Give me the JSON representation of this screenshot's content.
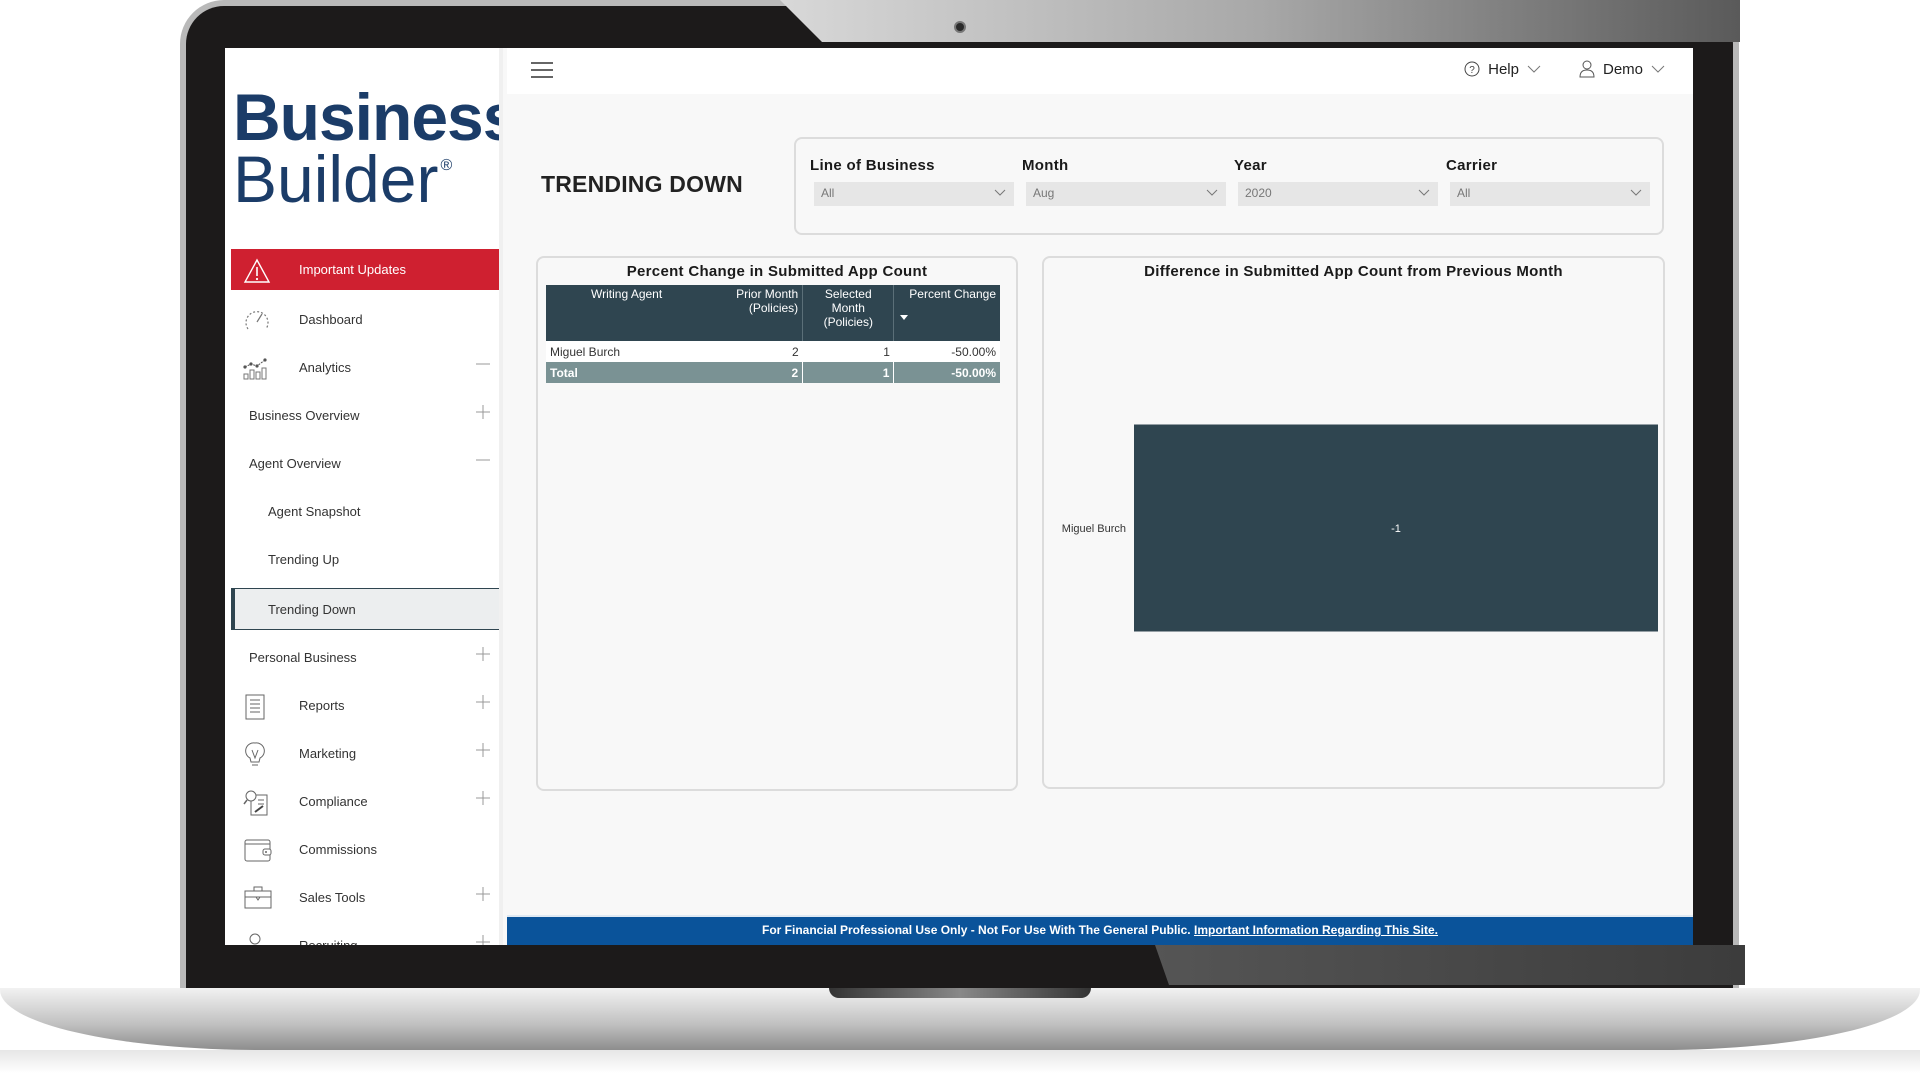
{
  "brand": {
    "line1": "Business",
    "line2": "Builder",
    "reg": "®"
  },
  "topbar": {
    "help_label": "Help",
    "user_label": "Demo"
  },
  "page": {
    "title": "TRENDING DOWN"
  },
  "sidebar": {
    "items": [
      {
        "label": "Important Updates",
        "icon": "warning-icon"
      },
      {
        "label": "Dashboard",
        "icon": "speedometer-icon"
      },
      {
        "label": "Analytics",
        "icon": "analytics-icon",
        "toggle": "minus"
      },
      {
        "label": "Business Overview",
        "toggle": "plus"
      },
      {
        "label": "Agent Overview",
        "toggle": "minus"
      },
      {
        "label": "Agent Snapshot"
      },
      {
        "label": "Trending Up"
      },
      {
        "label": "Trending Down",
        "active": true
      },
      {
        "label": "Personal Business",
        "toggle": "plus"
      },
      {
        "label": "Reports",
        "icon": "document-icon",
        "toggle": "plus"
      },
      {
        "label": "Marketing",
        "icon": "lightbulb-icon",
        "toggle": "plus"
      },
      {
        "label": "Compliance",
        "icon": "compliance-icon",
        "toggle": "plus"
      },
      {
        "label": "Commissions",
        "icon": "wallet-icon"
      },
      {
        "label": "Sales Tools",
        "icon": "briefcase-icon",
        "toggle": "plus"
      },
      {
        "label": "Recruiting",
        "icon": "person-icon",
        "toggle": "plus"
      }
    ]
  },
  "filters": [
    {
      "label": "Line of Business",
      "value": "All"
    },
    {
      "label": "Month",
      "value": "Aug"
    },
    {
      "label": "Year",
      "value": "2020"
    },
    {
      "label": "Carrier",
      "value": "All"
    }
  ],
  "table_panel": {
    "title": "Percent Change in Submitted App Count",
    "columns": [
      "Writing Agent",
      "Prior Month (Policies)",
      "Selected Month (Policies)",
      "Percent Change"
    ],
    "rows": [
      [
        "Miguel Burch",
        "2",
        "1",
        "-50.00%"
      ]
    ],
    "total": [
      "Total",
      "2",
      "1",
      "-50.00%"
    ]
  },
  "chart_data": {
    "type": "bar",
    "orientation": "horizontal",
    "title": "Difference in Submitted App Count from Previous Month",
    "categories": [
      "Miguel Burch"
    ],
    "values": [
      -1
    ],
    "data_labels": [
      "-1"
    ],
    "xlabel": "",
    "ylabel": "",
    "grid": false,
    "bar_color": "#2f4550"
  },
  "footer": {
    "text": "For Financial Professional Use Only - Not For Use With The General Public.",
    "link": "Important Information Regarding This Site."
  },
  "colors": {
    "brand": "#1b3c68",
    "alert": "#cf2030",
    "header_dark": "#2f4550",
    "total_row": "#7a9294",
    "footer": "#0a539a"
  }
}
